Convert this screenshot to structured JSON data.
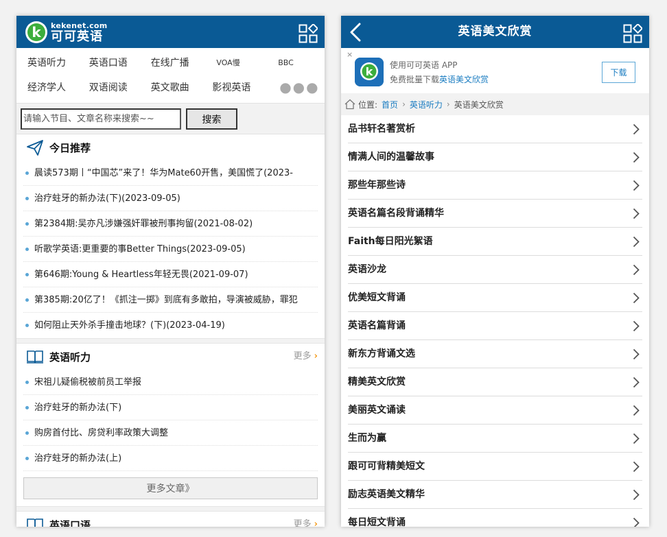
{
  "left": {
    "logo": {
      "domain": "kekenet.com",
      "name": "可可英语"
    },
    "nav": [
      "英语听力",
      "英语口语",
      "在线广播",
      "VOA慢",
      "BBC",
      "经济学人",
      "双语阅读",
      "英文歌曲",
      "影视英语",
      "●●●"
    ],
    "search": {
      "placeholder": "请输入节目、文章名称来搜索~~",
      "button": "搜索"
    },
    "today": {
      "title": "今日推荐",
      "items": [
        "晨读573期丨“中国芯”来了！华为Mate60开售，美国慌了(2023-",
        "治疗蛀牙的新办法(下)(2023-09-05)",
        "第2384期:吴亦凡涉嫌强奸罪被刑事拘留(2021-08-02)",
        "听歌学英语:更重要的事Better Things(2023-09-05)",
        "第646期:Young & Heartless年轻无畏(2021-09-07)",
        "第385期:20亿了！《抓注一掷》到底有多敢拍，导演被威胁，罪犯",
        "如何阻止天外杀手撞击地球？(下)(2023-04-19)"
      ]
    },
    "listening": {
      "title": "英语听力",
      "more": "更多",
      "items": [
        "宋祖儿疑偷税被前员工举报",
        "治疗蛀牙的新办法(下)",
        "购房首付比、房贷利率政策大调整",
        "治疗蛀牙的新办法(上)"
      ],
      "more_articles": "更多文章》"
    },
    "speaking": {
      "title": "英语口语",
      "more": "更多"
    }
  },
  "right": {
    "title": "英语美文欣赏",
    "banner": {
      "close": "×",
      "line1": "使用可可英语 APP",
      "line2_prefix": "免费批量下载",
      "line2_highlight": "英语美文欣赏",
      "download": "下载"
    },
    "crumb": {
      "label": "位置:",
      "home": "首页",
      "section": "英语听力",
      "current": "英语美文欣赏"
    },
    "items": [
      "品书轩名著赏析",
      "情满人间的温馨故事",
      "那些年那些诗",
      "英语名篇名段背诵精华",
      "Faith每日阳光絮语",
      "英语沙龙",
      "优美短文背诵",
      "英语名篇背诵",
      "新东方背诵文选",
      "精美英文欣赏",
      "美丽英文诵读",
      "生而为赢",
      "跟可可背精美短文",
      "励志英语美文精华",
      "每日短文背诵"
    ]
  },
  "colors": {
    "header": "#0a5a95",
    "link": "#1a7cc1",
    "accent": "#f49b1b"
  }
}
